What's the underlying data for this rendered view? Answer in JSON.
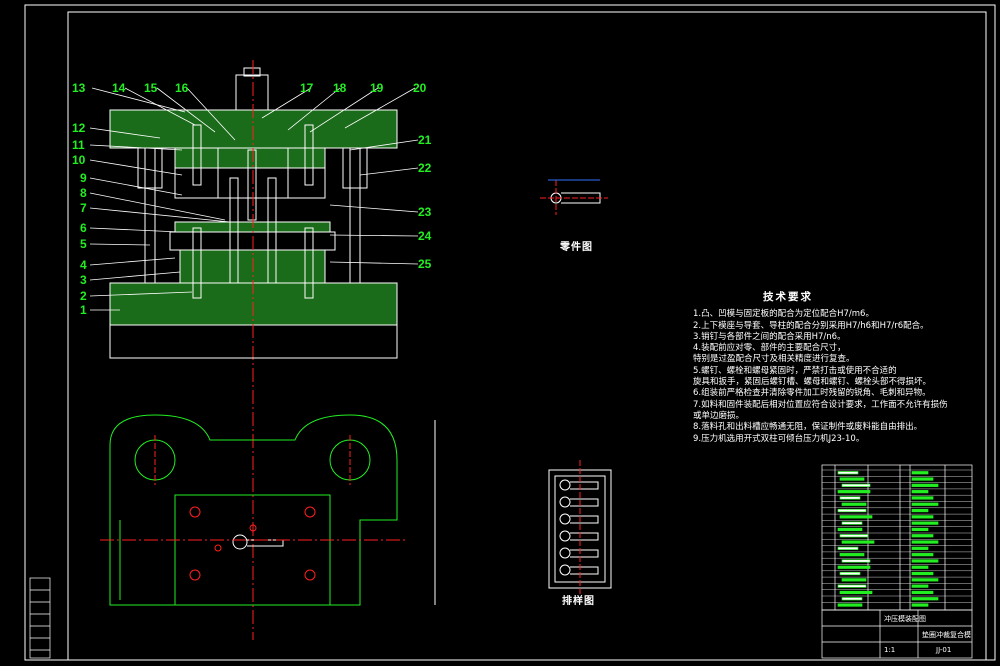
{
  "drawing": {
    "part_labels": [
      "1",
      "2",
      "3",
      "4",
      "5",
      "6",
      "7",
      "8",
      "9",
      "10",
      "11",
      "12",
      "13",
      "14",
      "15",
      "16",
      "17",
      "18",
      "19",
      "20",
      "21",
      "22",
      "23",
      "24",
      "25"
    ],
    "part_drawing_caption": "零件图",
    "strip_layout_caption": "排样图",
    "tech_title": "技术要求",
    "tech_lines": [
      "1.凸、凹模与固定板的配合为定位配合H7/m6。",
      "2.上下模座与导套、导柱的配合分别采用H7/h6和H7/r6配合。",
      "3.销钉与各部件之间的配合采用H7/n6。",
      "4.装配前应对零、部件的主要配合尺寸，",
      "  特别是过盈配合尺寸及相关精度进行复查。",
      "5.螺钉、螺栓和螺母紧固时，严禁打击或使用不合适的",
      "  旋具和扳手，紧固后螺钉槽、螺母和螺钉、螺栓头部不得损坏。",
      "6.组装前严格检查并清除零件加工时残留的锐角、毛刺和异物。",
      "7.如料和固件装配后相对位置应符合设计要求，工作面不允许有损伤",
      "  或单边磨损。",
      "8.落料孔和出料槽应畅通无阻，保证制件或废料能自由排出。",
      "9.压力机选用开式双柱可倾台压力机J23-10。"
    ],
    "title_block": {
      "drawing_name": "冲压模装配图",
      "part_name": "垫圈冲裁复合模",
      "scale": "1:1",
      "code": "JJ-01"
    }
  }
}
